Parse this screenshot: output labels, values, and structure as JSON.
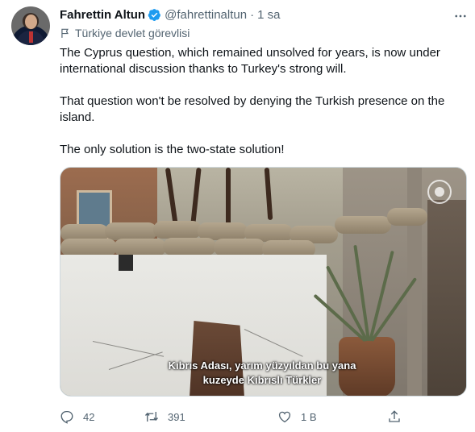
{
  "author": {
    "name": "Fahrettin Altun",
    "handle": "@fahrettinaltun",
    "separator": "·",
    "time": "1 sa",
    "label": "Türkiye devlet görevlisi"
  },
  "tweet": {
    "paragraphs": [
      "The Cyprus question, which remained unsolved for years, is now under international discussion thanks to Turkey's strong will.",
      "That question won't be resolved by denying the Turkish presence on the island.",
      "The only solution is the two-state solution!"
    ]
  },
  "media": {
    "subtitle_line1": "Kıbrıs Adası, yarım yüzyıldan bu yana",
    "subtitle_line2": "kuzeyde Kıbrıslı Türkler"
  },
  "actions": {
    "replies": "42",
    "retweets": "391",
    "likes": "1 B"
  },
  "colors": {
    "text": "#0f1419",
    "secondary": "#536471",
    "verified": "#1d9bf0",
    "border": "#cfd9de"
  },
  "icons": [
    "verified-badge-icon",
    "more-icon",
    "flag-icon",
    "reply-icon",
    "retweet-icon",
    "like-icon",
    "share-icon",
    "watermark-logo"
  ]
}
